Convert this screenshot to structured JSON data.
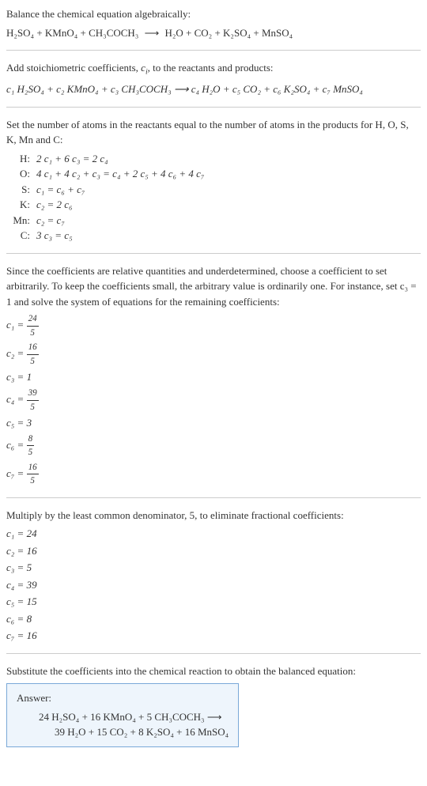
{
  "intro": {
    "line1": "Balance the chemical equation algebraically:",
    "eq_lhs": "H₂SO₄ + KMnO₄ + CH₃COCH₃",
    "arrow": "⟶",
    "eq_rhs": "H₂O + CO₂ + K₂SO₄ + MnSO₄"
  },
  "stoich": {
    "line1_a": "Add stoichiometric coefficients, ",
    "line1_b": "c",
    "line1_c": "i",
    "line1_d": ", to the reactants and products:",
    "eq": "c₁ H₂SO₄ + c₂ KMnO₄ + c₃ CH₃COCH₃ ⟶ c₄ H₂O + c₅ CO₂ + c₆ K₂SO₄ + c₇ MnSO₄"
  },
  "atoms": {
    "intro": "Set the number of atoms in the reactants equal to the number of atoms in the products for H, O, S, K, Mn and C:",
    "rows": [
      {
        "label": "H:",
        "eq": "2 c₁ + 6 c₃ = 2 c₄"
      },
      {
        "label": "O:",
        "eq": "4 c₁ + 4 c₂ + c₃ = c₄ + 2 c₅ + 4 c₆ + 4 c₇"
      },
      {
        "label": "S:",
        "eq": "c₁ = c₆ + c₇"
      },
      {
        "label": "K:",
        "eq": "c₂ = 2 c₆"
      },
      {
        "label": "Mn:",
        "eq": "c₂ = c₇"
      },
      {
        "label": "C:",
        "eq": "3 c₃ = c₅"
      }
    ]
  },
  "solve": {
    "intro": "Since the coefficients are relative quantities and underdetermined, choose a coefficient to set arbitrarily. To keep the coefficients small, the arbitrary value is ordinarily one. For instance, set c₃ = 1 and solve the system of equations for the remaining coefficients:",
    "rows": [
      {
        "var": "c₁",
        "num": "24",
        "den": "5",
        "is_frac": true
      },
      {
        "var": "c₂",
        "num": "16",
        "den": "5",
        "is_frac": true
      },
      {
        "var": "c₃",
        "val": "1",
        "is_frac": false
      },
      {
        "var": "c₄",
        "num": "39",
        "den": "5",
        "is_frac": true
      },
      {
        "var": "c₅",
        "val": "3",
        "is_frac": false
      },
      {
        "var": "c₆",
        "num": "8",
        "den": "5",
        "is_frac": true
      },
      {
        "var": "c₇",
        "num": "16",
        "den": "5",
        "is_frac": true
      }
    ]
  },
  "multiply": {
    "intro": "Multiply by the least common denominator, 5, to eliminate fractional coefficients:",
    "rows": [
      {
        "var": "c₁",
        "val": "24"
      },
      {
        "var": "c₂",
        "val": "16"
      },
      {
        "var": "c₃",
        "val": "5"
      },
      {
        "var": "c₄",
        "val": "39"
      },
      {
        "var": "c₅",
        "val": "15"
      },
      {
        "var": "c₆",
        "val": "8"
      },
      {
        "var": "c₇",
        "val": "16"
      }
    ]
  },
  "final": {
    "intro": "Substitute the coefficients into the chemical reaction to obtain the balanced equation:",
    "answer_label": "Answer:",
    "line1": "24 H₂SO₄ + 16 KMnO₄ + 5 CH₃COCH₃ ⟶",
    "line2": "39 H₂O + 15 CO₂ + 8 K₂SO₄ + 16 MnSO₄"
  }
}
